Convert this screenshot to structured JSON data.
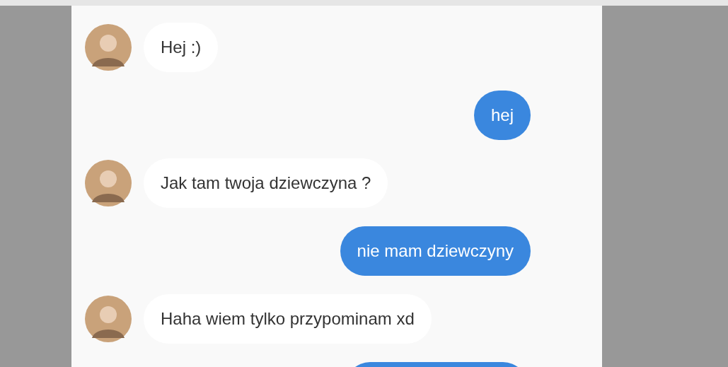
{
  "messages": [
    {
      "kind": "received",
      "text": "Hej :)"
    },
    {
      "kind": "sent",
      "text": "hej"
    },
    {
      "kind": "received",
      "text": "Jak tam twoja dziewczyna ?"
    },
    {
      "kind": "sent",
      "text": "nie mam dziewczyny"
    },
    {
      "kind": "received",
      "text": "Haha wiem tylko przypominam xd"
    },
    {
      "kind": "partial"
    }
  ]
}
